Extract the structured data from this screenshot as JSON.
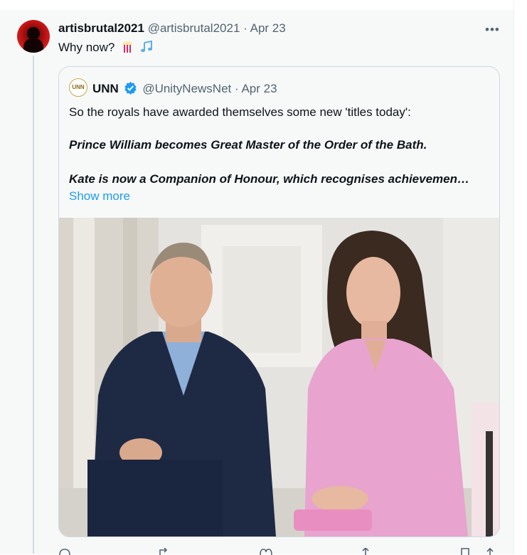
{
  "tweet": {
    "display_name": "artisbrutal2021",
    "handle": "@artisbrutal2021",
    "separator": "·",
    "date": "Apr 23",
    "text": "Why now?",
    "emojis": [
      "popcorn-emoji",
      "music-notes-emoji"
    ],
    "more_icon": "more-icon"
  },
  "quoted": {
    "avatar_text": "UNN",
    "display_name": "UNN",
    "verified_icon": "verified-badge-icon",
    "handle": "@UnityNewsNet",
    "separator": "·",
    "date": "Apr 23",
    "lines": [
      "So the royals have awarded themselves some new 'titles today':",
      "Prince William becomes Great Master of the Order of the Bath.",
      "Kate is now a Companion of Honour, which recognises achievemen…"
    ],
    "show_more": "Show more",
    "image_alt": "photo"
  },
  "actions": {
    "reply_icon": "reply-icon",
    "retweet_icon": "retweet-icon",
    "like_icon": "like-icon",
    "views_icon": "views-icon",
    "bookmark_icon": "bookmark-icon",
    "share_icon": "share-icon"
  },
  "colors": {
    "accent": "#1d9bf0",
    "muted": "#536471",
    "text": "#0f1419",
    "background": "#f7f9f9"
  }
}
